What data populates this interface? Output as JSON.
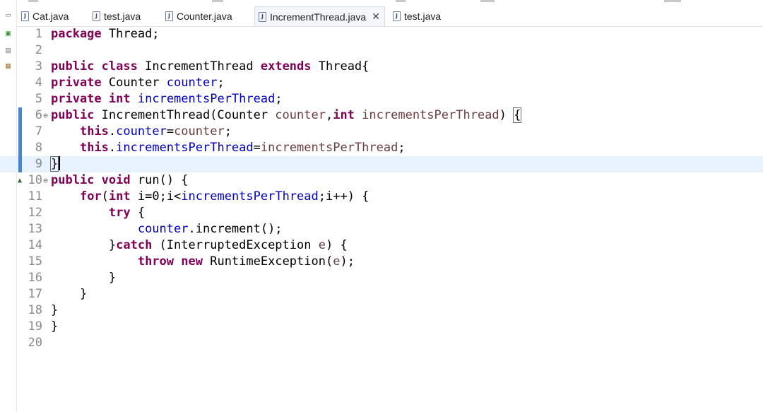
{
  "tabs": [
    {
      "label": "Cat.java",
      "active": false
    },
    {
      "label": "test.java",
      "active": false
    },
    {
      "label": "Counter.java",
      "active": false
    },
    {
      "label": "IncrementThread.java",
      "active": true,
      "closable": true
    },
    {
      "label": "test.java",
      "active": false
    }
  ],
  "file_icon_glyph": "J",
  "close_glyph": "✕",
  "fold_glyph": "⊖",
  "override_glyph": "▲",
  "icons": [
    "minimize-icon",
    "restore-icon",
    "package-explorer-icon",
    "hierarchy-icon",
    "java-file-icon",
    "close-icon",
    "fold-icon",
    "override-arrow-icon"
  ],
  "colors": {
    "keyword": "#7f0055",
    "field": "#0000c0",
    "parameter": "#6a3e3e",
    "line_number": "#8a8a8a",
    "current_line": "#e8f2fe",
    "change_bar": "#4f83c8"
  },
  "current_line": 9,
  "changed_lines": [
    6,
    7,
    8,
    9
  ],
  "lines": [
    {
      "num": "1",
      "tokens": [
        {
          "t": "package",
          "c": "kw"
        },
        {
          "t": " Thread;"
        }
      ]
    },
    {
      "num": "2",
      "tokens": []
    },
    {
      "num": "3",
      "tokens": [
        {
          "t": "public",
          "c": "kw"
        },
        {
          "t": " "
        },
        {
          "t": "class",
          "c": "kw"
        },
        {
          "t": " IncrementThread "
        },
        {
          "t": "extends",
          "c": "kw"
        },
        {
          "t": " Thread{"
        }
      ]
    },
    {
      "num": "4",
      "tokens": [
        {
          "t": "private",
          "c": "kw"
        },
        {
          "t": " Counter "
        },
        {
          "t": "counter",
          "c": "fld"
        },
        {
          "t": ";"
        }
      ]
    },
    {
      "num": "5",
      "tokens": [
        {
          "t": "private",
          "c": "kw"
        },
        {
          "t": " "
        },
        {
          "t": "int",
          "c": "kw"
        },
        {
          "t": " "
        },
        {
          "t": "incrementsPerThread",
          "c": "fld"
        },
        {
          "t": ";"
        }
      ]
    },
    {
      "num": "6",
      "fold": true,
      "tokens": [
        {
          "t": "public",
          "c": "kw"
        },
        {
          "t": " IncrementThread(Counter "
        },
        {
          "t": "counter",
          "c": "prm"
        },
        {
          "t": ","
        },
        {
          "t": "int",
          "c": "kw"
        },
        {
          "t": " "
        },
        {
          "t": "incrementsPerThread",
          "c": "prm"
        },
        {
          "t": ") "
        },
        {
          "t": "{",
          "c": "brk"
        }
      ]
    },
    {
      "num": "7",
      "tokens": [
        {
          "t": "    "
        },
        {
          "t": "this",
          "c": "kw"
        },
        {
          "t": "."
        },
        {
          "t": "counter",
          "c": "fld"
        },
        {
          "t": "="
        },
        {
          "t": "counter",
          "c": "prm"
        },
        {
          "t": ";"
        }
      ]
    },
    {
      "num": "8",
      "tokens": [
        {
          "t": "    "
        },
        {
          "t": "this",
          "c": "kw"
        },
        {
          "t": "."
        },
        {
          "t": "incrementsPerThread",
          "c": "fld"
        },
        {
          "t": "="
        },
        {
          "t": "incrementsPerThread",
          "c": "prm"
        },
        {
          "t": ";"
        }
      ]
    },
    {
      "num": "9",
      "caret": true,
      "tokens": [
        {
          "t": "}",
          "c": "brk"
        }
      ]
    },
    {
      "num": "10",
      "fold": true,
      "override": true,
      "tokens": [
        {
          "t": "public",
          "c": "kw"
        },
        {
          "t": " "
        },
        {
          "t": "void",
          "c": "kw"
        },
        {
          "t": " run() {"
        }
      ]
    },
    {
      "num": "11",
      "tokens": [
        {
          "t": "    "
        },
        {
          "t": "for",
          "c": "kw"
        },
        {
          "t": "("
        },
        {
          "t": "int",
          "c": "kw"
        },
        {
          "t": " i=0;i<"
        },
        {
          "t": "incrementsPerThread",
          "c": "fld"
        },
        {
          "t": ";i++) {"
        }
      ]
    },
    {
      "num": "12",
      "tokens": [
        {
          "t": "        "
        },
        {
          "t": "try",
          "c": "kw"
        },
        {
          "t": " {"
        }
      ]
    },
    {
      "num": "13",
      "tokens": [
        {
          "t": "            "
        },
        {
          "t": "counter",
          "c": "fld"
        },
        {
          "t": ".increment();"
        }
      ]
    },
    {
      "num": "14",
      "tokens": [
        {
          "t": "        }"
        },
        {
          "t": "catch",
          "c": "kw"
        },
        {
          "t": " (InterruptedException "
        },
        {
          "t": "e",
          "c": "prm"
        },
        {
          "t": ") {"
        }
      ]
    },
    {
      "num": "15",
      "tokens": [
        {
          "t": "            "
        },
        {
          "t": "throw",
          "c": "kw"
        },
        {
          "t": " "
        },
        {
          "t": "new",
          "c": "kw"
        },
        {
          "t": " RuntimeException("
        },
        {
          "t": "e",
          "c": "prm"
        },
        {
          "t": ");"
        }
      ]
    },
    {
      "num": "16",
      "tokens": [
        {
          "t": "        }"
        }
      ]
    },
    {
      "num": "17",
      "tokens": [
        {
          "t": "    }"
        }
      ]
    },
    {
      "num": "18",
      "tokens": [
        {
          "t": "}"
        }
      ]
    },
    {
      "num": "19",
      "tokens": [
        {
          "t": "}"
        }
      ]
    },
    {
      "num": "20",
      "tokens": []
    }
  ]
}
